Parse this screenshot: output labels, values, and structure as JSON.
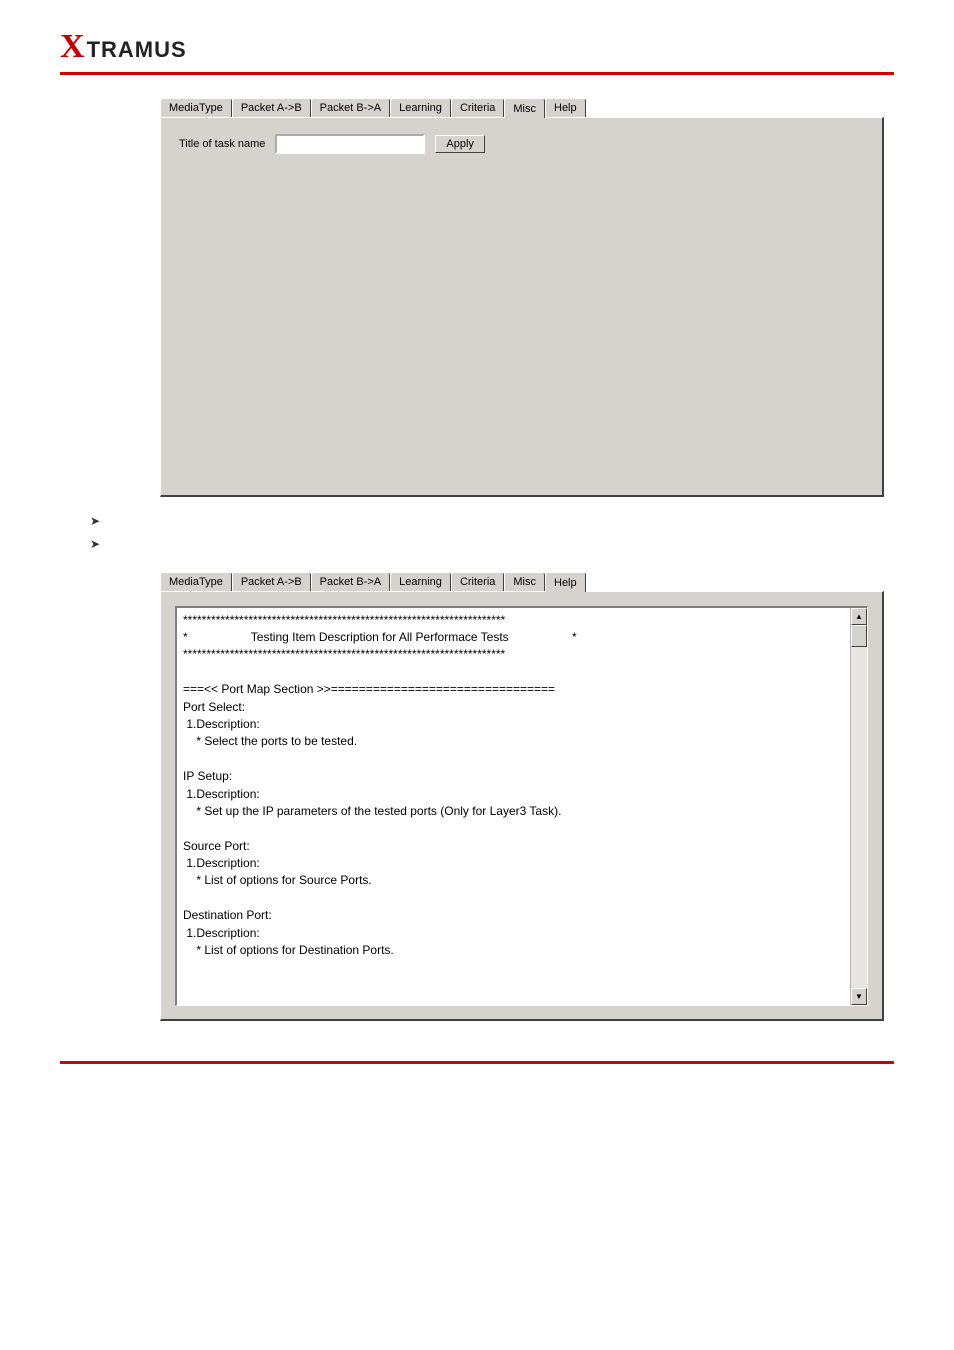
{
  "logo": {
    "x": "X",
    "rest": "TRAMUS"
  },
  "misc_panel": {
    "tabs": [
      "MediaType",
      "Packet A->B",
      "Packet B->A",
      "Learning",
      "Criteria",
      "Misc",
      "Help"
    ],
    "selected_index": 5,
    "title_label": "Title of task name",
    "title_value": "",
    "apply_label": "Apply"
  },
  "bullets": [
    "",
    ""
  ],
  "help_panel": {
    "tabs": [
      "MediaType",
      "Packet A->B",
      "Packet B->A",
      "Learning",
      "Criteria",
      "Misc",
      "Help"
    ],
    "selected_index": 6,
    "text": "*********************************************************************\n*                   Testing Item Description for All Performace Tests                   *\n*********************************************************************\n\n===<< Port Map Section >>================================\nPort Select:\n 1.Description:\n    * Select the ports to be tested.\n\nIP Setup:\n 1.Description:\n    * Set up the IP parameters of the tested ports (Only for Layer3 Task).\n\nSource Port:\n 1.Description:\n    * List of options for Source Ports.\n\nDestination Port:\n 1.Description:\n    * List of options for Destination Ports."
  }
}
